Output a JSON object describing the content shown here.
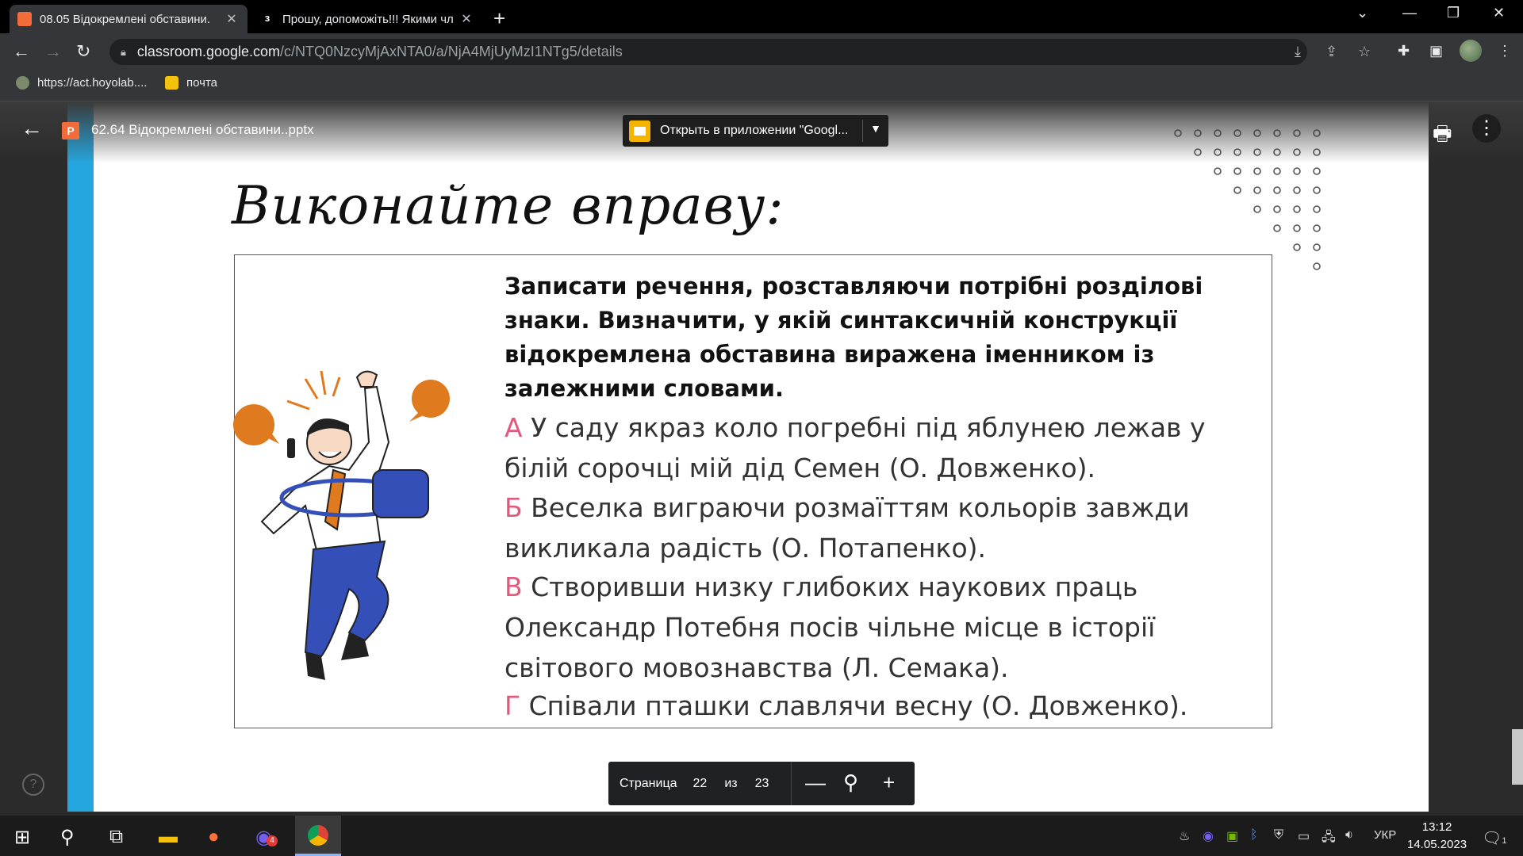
{
  "browser": {
    "tabs": [
      {
        "title": "08.05 Відокремлені обставини.",
        "active": true
      },
      {
        "title": "Прошу, допоможіть!!! Якими чл",
        "active": false
      }
    ],
    "url_host": "classroom.google.com",
    "url_path": "/c/NTQ0NzcyMjAxNTA0/a/NjA4MjUyMzI1NTg5/details",
    "bookmarks": [
      {
        "label": "https://act.hoyolab...."
      },
      {
        "label": "почта"
      }
    ]
  },
  "viewer": {
    "file_name": "62.64 Відокремлені обставини..pptx",
    "file_icon_letter": "P",
    "open_with_label": "Открыть в приложении \"Googl...",
    "page_label": "Страница",
    "page_current": "22",
    "page_of": "из",
    "page_total": "23"
  },
  "slide": {
    "heading": "Виконайте вправу:",
    "task": "Записати речення, розставляючи потрібні розділові знаки. Визначити, у якій синтаксичній конструкції відокремлена обставина виражена іменником із залежними словами.",
    "sentences": [
      {
        "letter": "А",
        "text": "  У саду якраз коло погребні під яблунею лежав у білій сорочці мій дід Семен (О. Довженко)."
      },
      {
        "letter": "Б",
        "text": "  Веселка виграючи розмаїттям кольорів завжди викликала радість (О. Потапенко)."
      },
      {
        "letter": "В",
        "text": " Створивши низку глибоких наукових праць Олександр Потебня посів чільне місце в історії світового мовознавства  (Л. Семака)."
      },
      {
        "letter": "Г",
        "text": " Співали пташки славлячи весну (О. Довженко)."
      }
    ]
  },
  "taskbar": {
    "lang": "УКР",
    "time": "13:12",
    "date": "14.05.2023",
    "viber_badge": "4",
    "notif_count": "1"
  },
  "colors": {
    "accent_letter": "#e05a7e",
    "slide_border": "#26a6de",
    "orange": "#e07a1f",
    "blue_suit": "#3450b8"
  }
}
